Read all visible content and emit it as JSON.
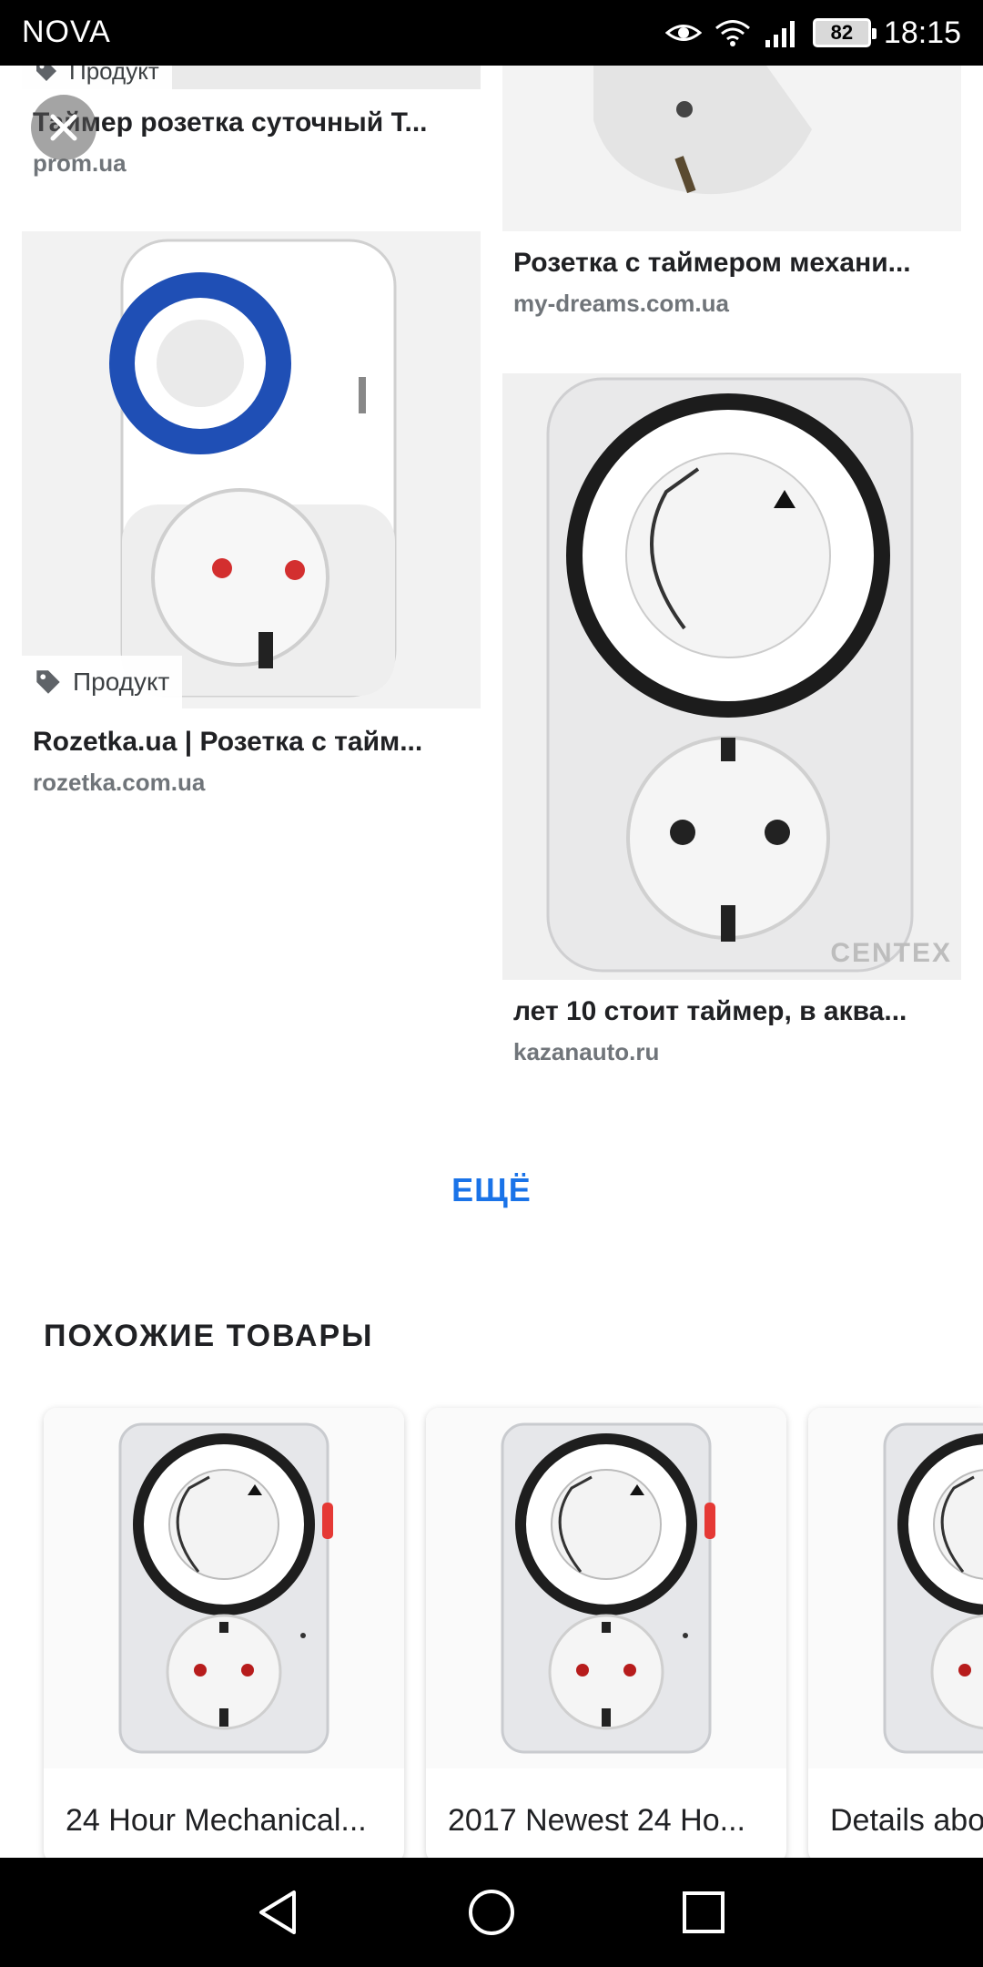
{
  "status_bar": {
    "carrier": "NOVA",
    "battery": "82",
    "time": "18:15"
  },
  "results": [
    {
      "title": "Таймер розетка суточный Т...",
      "source": "prom.ua",
      "tag": "Продукт"
    },
    {
      "title": "Розетка с таймером механи...",
      "source": "my-dreams.com.ua"
    },
    {
      "title": "Rozetka.ua | Розетка с тайм...",
      "source": "rozetka.com.ua",
      "tag": "Продукт"
    },
    {
      "title": "лет 10 стоит таймер, в аква...",
      "source": "kazanauto.ru",
      "watermark": "CENTEX"
    }
  ],
  "more_button": "ЕЩЁ",
  "similar": {
    "heading": "ПОХОЖИЕ ТОВАРЫ",
    "items": [
      {
        "title": "24 Hour Mechanical..."
      },
      {
        "title": "2017 Newest 24 Ho..."
      },
      {
        "title": "Details abo"
      }
    ]
  },
  "colors": {
    "accent": "#1a73e8",
    "timer_blue": "#1f4fb5",
    "socket_red": "#d32f2f"
  },
  "icons": [
    "close-icon",
    "tag-icon",
    "eye-icon",
    "wifi-icon",
    "signal-icon",
    "battery-icon",
    "back-icon",
    "home-icon",
    "recents-icon"
  ]
}
